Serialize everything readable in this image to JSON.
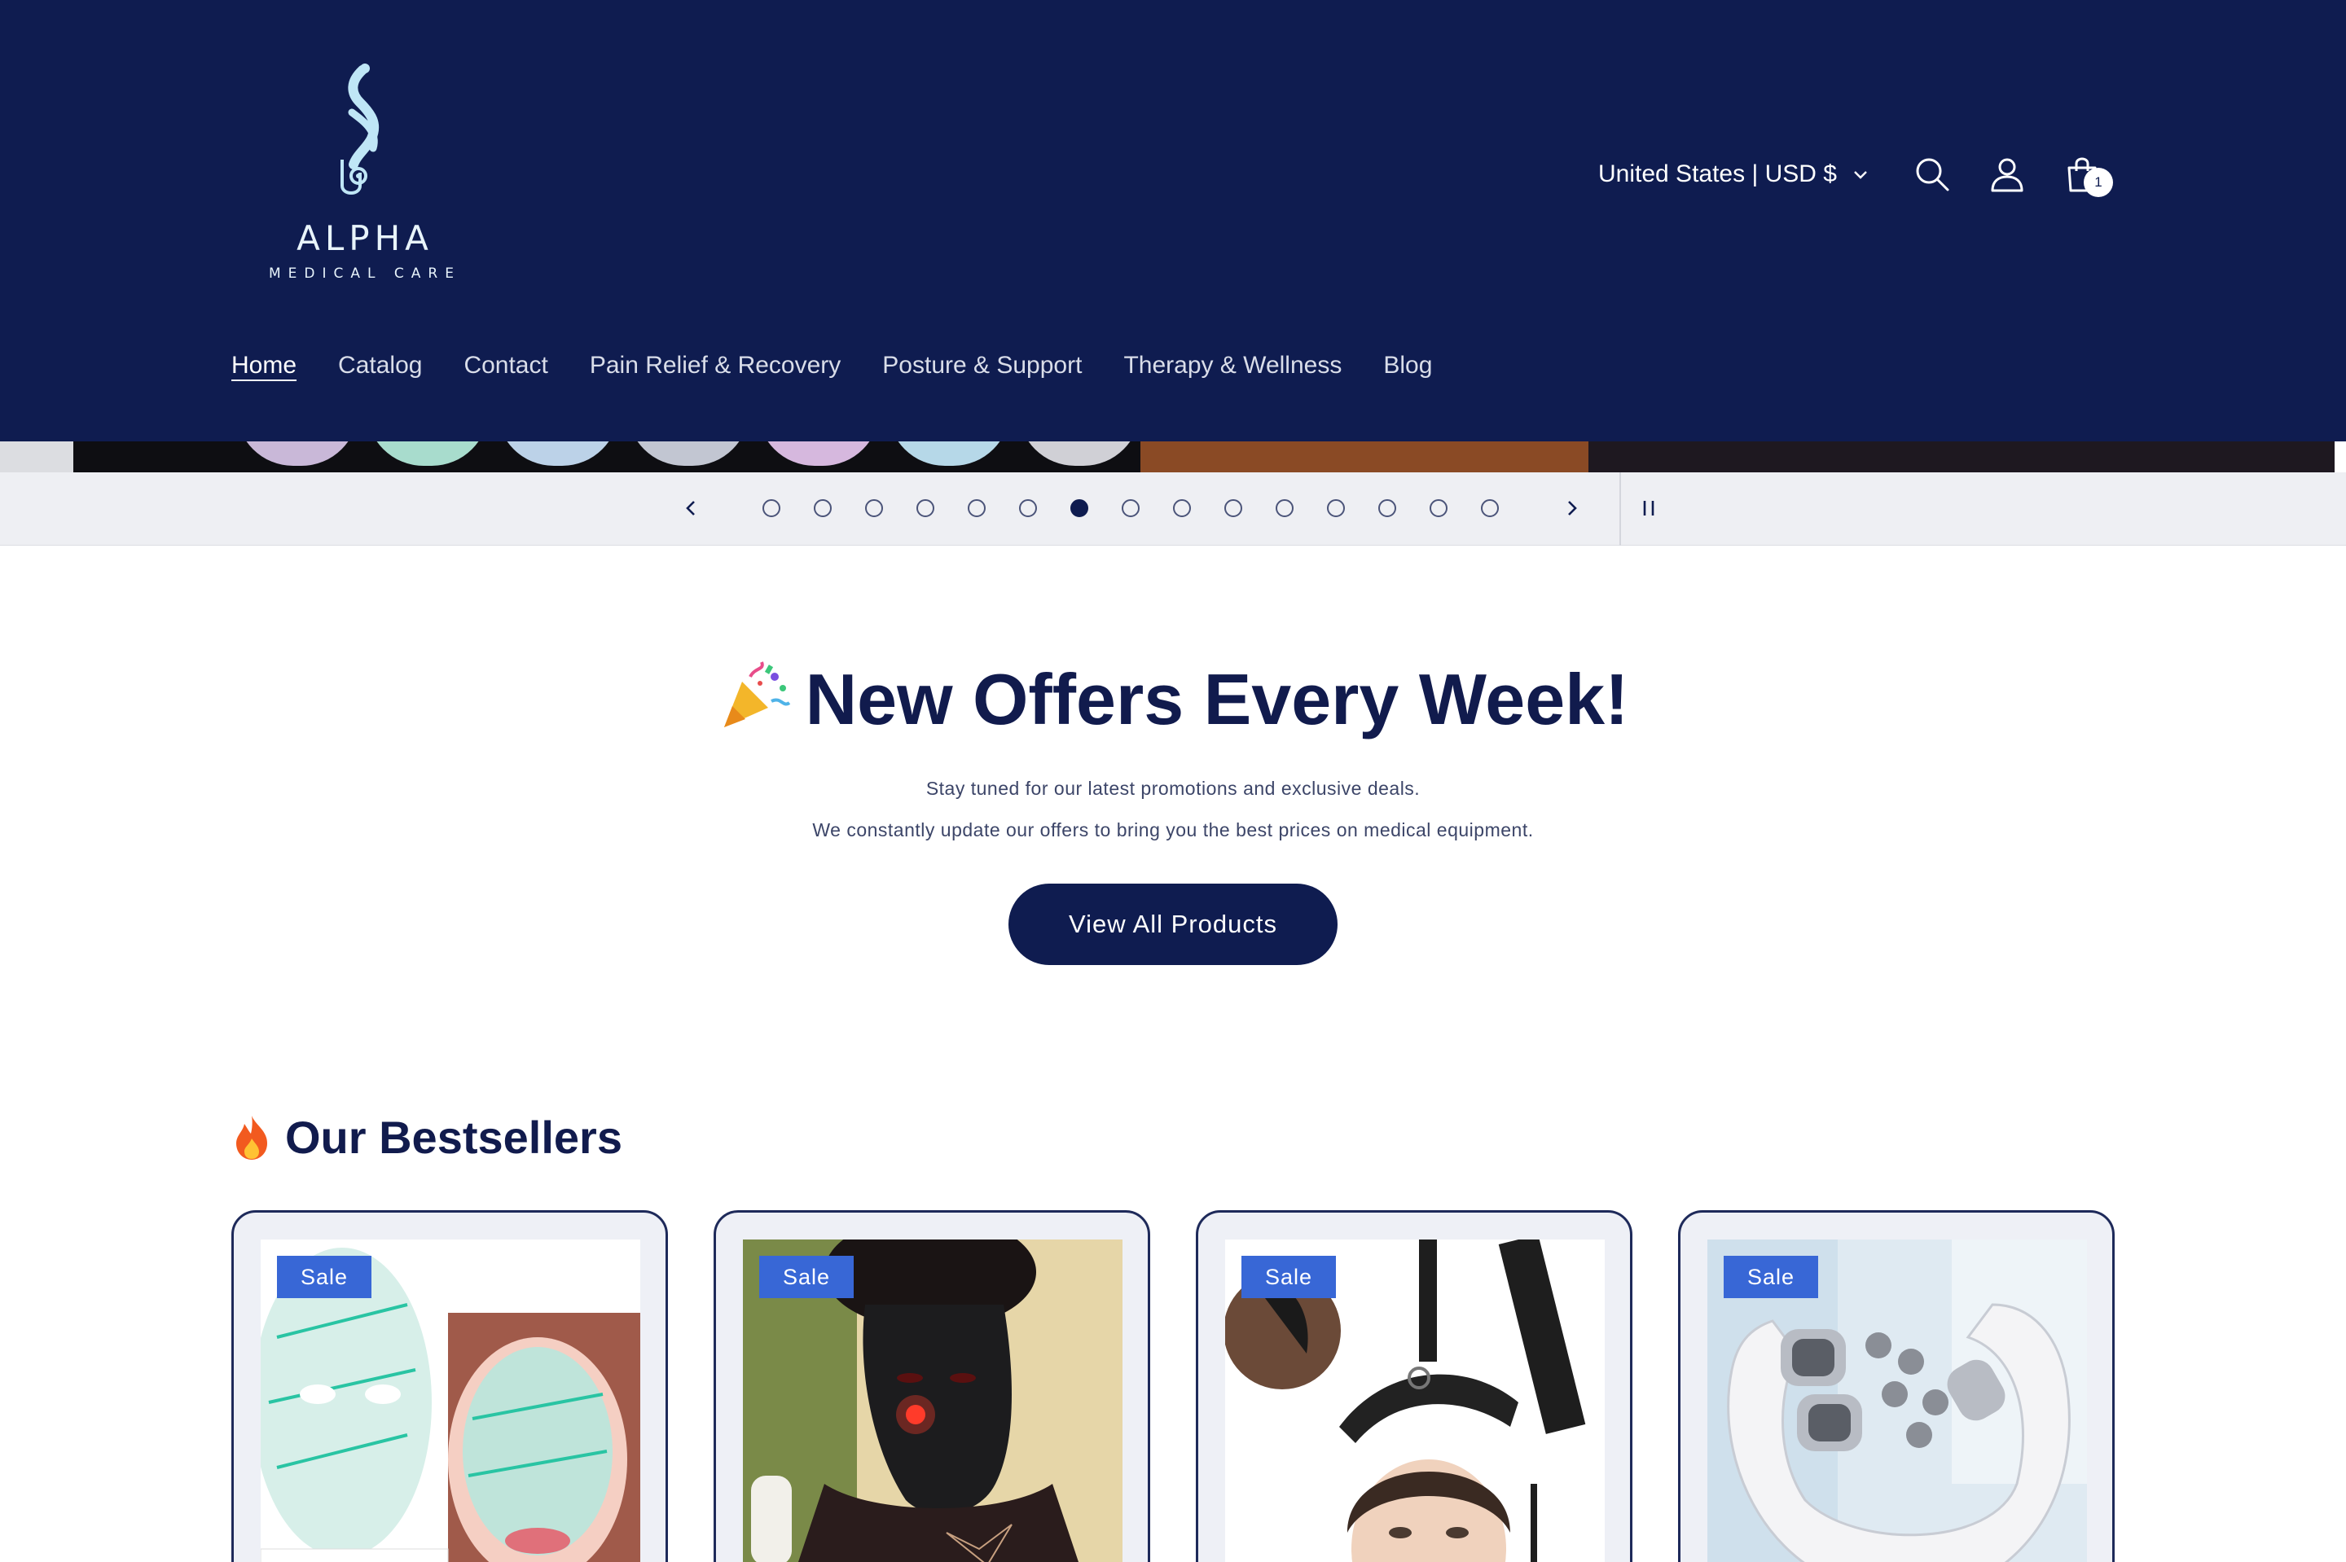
{
  "brand": {
    "name": "ALPHA",
    "tagline": "MEDICAL CARE",
    "colors": {
      "navy": "#0f1c50",
      "accent": "#3867d6",
      "logo_light": "#bfe6f6"
    }
  },
  "header": {
    "country_selector": "United States | USD $",
    "icons": [
      "search-icon",
      "account-icon",
      "cart-icon"
    ],
    "cart_count": "1"
  },
  "nav": {
    "items": [
      {
        "label": "Home",
        "active": true
      },
      {
        "label": "Catalog"
      },
      {
        "label": "Contact"
      },
      {
        "label": "Pain Relief & Recovery"
      },
      {
        "label": "Posture & Support"
      },
      {
        "label": "Therapy & Wellness"
      },
      {
        "label": "Blog"
      }
    ]
  },
  "slideshow": {
    "slide_count": 15,
    "active_slide": 7,
    "icons": [
      "chevron-left-icon",
      "chevron-right-icon",
      "pause-icon"
    ]
  },
  "offers": {
    "title": "New Offers Every Week!",
    "title_icon": "party-popper-icon",
    "line1": "Stay tuned for our latest promotions and exclusive deals.",
    "line2": "We constantly update our offers to bring you the best prices on medical equipment.",
    "cta_label": "View All Products"
  },
  "bestsellers": {
    "title": "Our Bestsellers",
    "title_icon": "fire-icon",
    "products": [
      {
        "badge": "Sale",
        "image": "led-face-mask-product"
      },
      {
        "badge": "Sale",
        "image": "red-light-therapy-mask-product"
      },
      {
        "badge": "Sale",
        "image": "neck-traction-device-product"
      },
      {
        "badge": "Sale",
        "image": "neck-massager-product"
      }
    ]
  }
}
